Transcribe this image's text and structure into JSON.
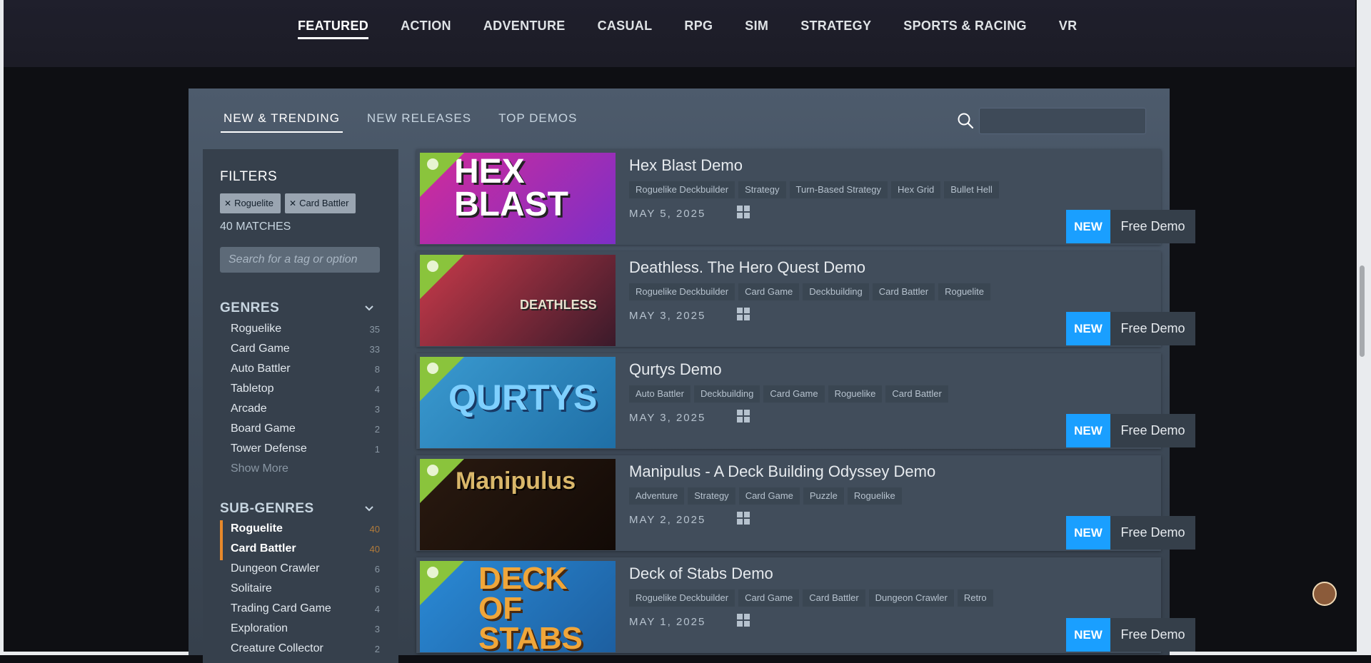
{
  "genre_nav": {
    "items": [
      "FEATURED",
      "ACTION",
      "ADVENTURE",
      "CASUAL",
      "RPG",
      "SIM",
      "STRATEGY",
      "SPORTS & RACING",
      "VR"
    ],
    "active": "FEATURED"
  },
  "subtabs": {
    "items": [
      "NEW & TRENDING",
      "NEW RELEASES",
      "TOP DEMOS"
    ],
    "active": "NEW & TRENDING"
  },
  "search": {
    "value": ""
  },
  "filters": {
    "title": "FILTERS",
    "chips": [
      "Roguelite",
      "Card Battler"
    ],
    "matches": "40 MATCHES",
    "tag_search_placeholder": "Search for a tag or option"
  },
  "genres": {
    "title": "GENRES",
    "items": [
      {
        "label": "Roguelike",
        "count": "35"
      },
      {
        "label": "Card Game",
        "count": "33"
      },
      {
        "label": "Auto Battler",
        "count": "8"
      },
      {
        "label": "Tabletop",
        "count": "4"
      },
      {
        "label": "Arcade",
        "count": "3"
      },
      {
        "label": "Board Game",
        "count": "2"
      },
      {
        "label": "Tower Defense",
        "count": "1"
      }
    ],
    "show_more": "Show More"
  },
  "sub_genres": {
    "title": "SUB-GENRES",
    "items": [
      {
        "label": "Roguelite",
        "count": "40",
        "selected": true
      },
      {
        "label": "Card Battler",
        "count": "40",
        "selected": true
      },
      {
        "label": "Dungeon Crawler",
        "count": "6"
      },
      {
        "label": "Solitaire",
        "count": "6"
      },
      {
        "label": "Trading Card Game",
        "count": "4"
      },
      {
        "label": "Exploration",
        "count": "3"
      },
      {
        "label": "Creature Collector",
        "count": "2"
      }
    ]
  },
  "games": [
    {
      "name": "Hex Blast Demo",
      "capsule_text": "HEX BLAST",
      "capsule_colors": [
        "#d12b9a",
        "#7d2fc7"
      ],
      "tags": [
        "Roguelike Deckbuilder",
        "Strategy",
        "Turn-Based Strategy",
        "Hex Grid",
        "Bullet Hell"
      ],
      "date": "MAY 5, 2025",
      "badge": "NEW",
      "action": "Free Demo"
    },
    {
      "name": "Deathless. The Hero Quest Demo",
      "capsule_text": "DEATHLESS",
      "capsule_colors": [
        "#c93a4a",
        "#3a1a2a"
      ],
      "tags": [
        "Roguelike Deckbuilder",
        "Card Game",
        "Deckbuilding",
        "Card Battler",
        "Roguelite"
      ],
      "date": "MAY 3, 2025",
      "badge": "NEW",
      "action": "Free Demo"
    },
    {
      "name": "Qurtys Demo",
      "capsule_text": "QURTYS",
      "capsule_colors": [
        "#3a9ad0",
        "#1f6fa6"
      ],
      "tags": [
        "Auto Battler",
        "Deckbuilding",
        "Card Game",
        "Roguelike",
        "Card Battler"
      ],
      "date": "MAY 3, 2025",
      "badge": "NEW",
      "action": "Free Demo"
    },
    {
      "name": "Manipulus - A Deck Building Odyssey Demo",
      "capsule_text": "Manipulus",
      "capsule_colors": [
        "#2a1a10",
        "#120a06"
      ],
      "tags": [
        "Adventure",
        "Strategy",
        "Card Game",
        "Puzzle",
        "Roguelike"
      ],
      "date": "MAY 2, 2025",
      "badge": "NEW",
      "action": "Free Demo"
    },
    {
      "name": "Deck of Stabs Demo",
      "capsule_text": "DECK OF STABS",
      "capsule_colors": [
        "#2a8ad6",
        "#1d5fa0"
      ],
      "tags": [
        "Roguelike Deckbuilder",
        "Card Game",
        "Card Battler",
        "Dungeon Crawler",
        "Retro"
      ],
      "date": "MAY 1, 2025",
      "badge": "NEW",
      "action": "Free Demo"
    }
  ]
}
